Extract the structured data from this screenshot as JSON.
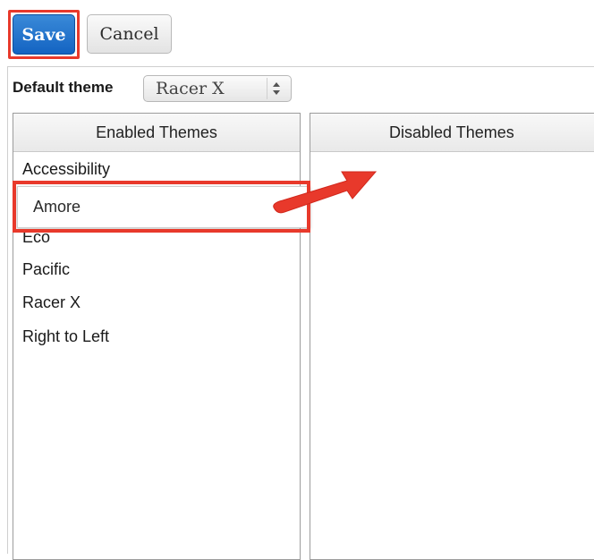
{
  "toolbar": {
    "save_label": "Save",
    "cancel_label": "Cancel"
  },
  "default_theme": {
    "label": "Default theme",
    "selected": "Racer X"
  },
  "enabled_themes": {
    "header": "Enabled Themes",
    "items": [
      "Accessibility",
      "Eco",
      "Pacific",
      "Racer X",
      "Right to Left"
    ]
  },
  "dragged_item": {
    "label": "Amore"
  },
  "disabled_themes": {
    "header": "Disabled Themes",
    "items": []
  },
  "colors": {
    "primary": "#1363c2",
    "highlight": "#e8392b"
  },
  "icons": {
    "select_arrows": "up-down-chevron-icon",
    "drag_arrow": "arrow-right-icon"
  }
}
